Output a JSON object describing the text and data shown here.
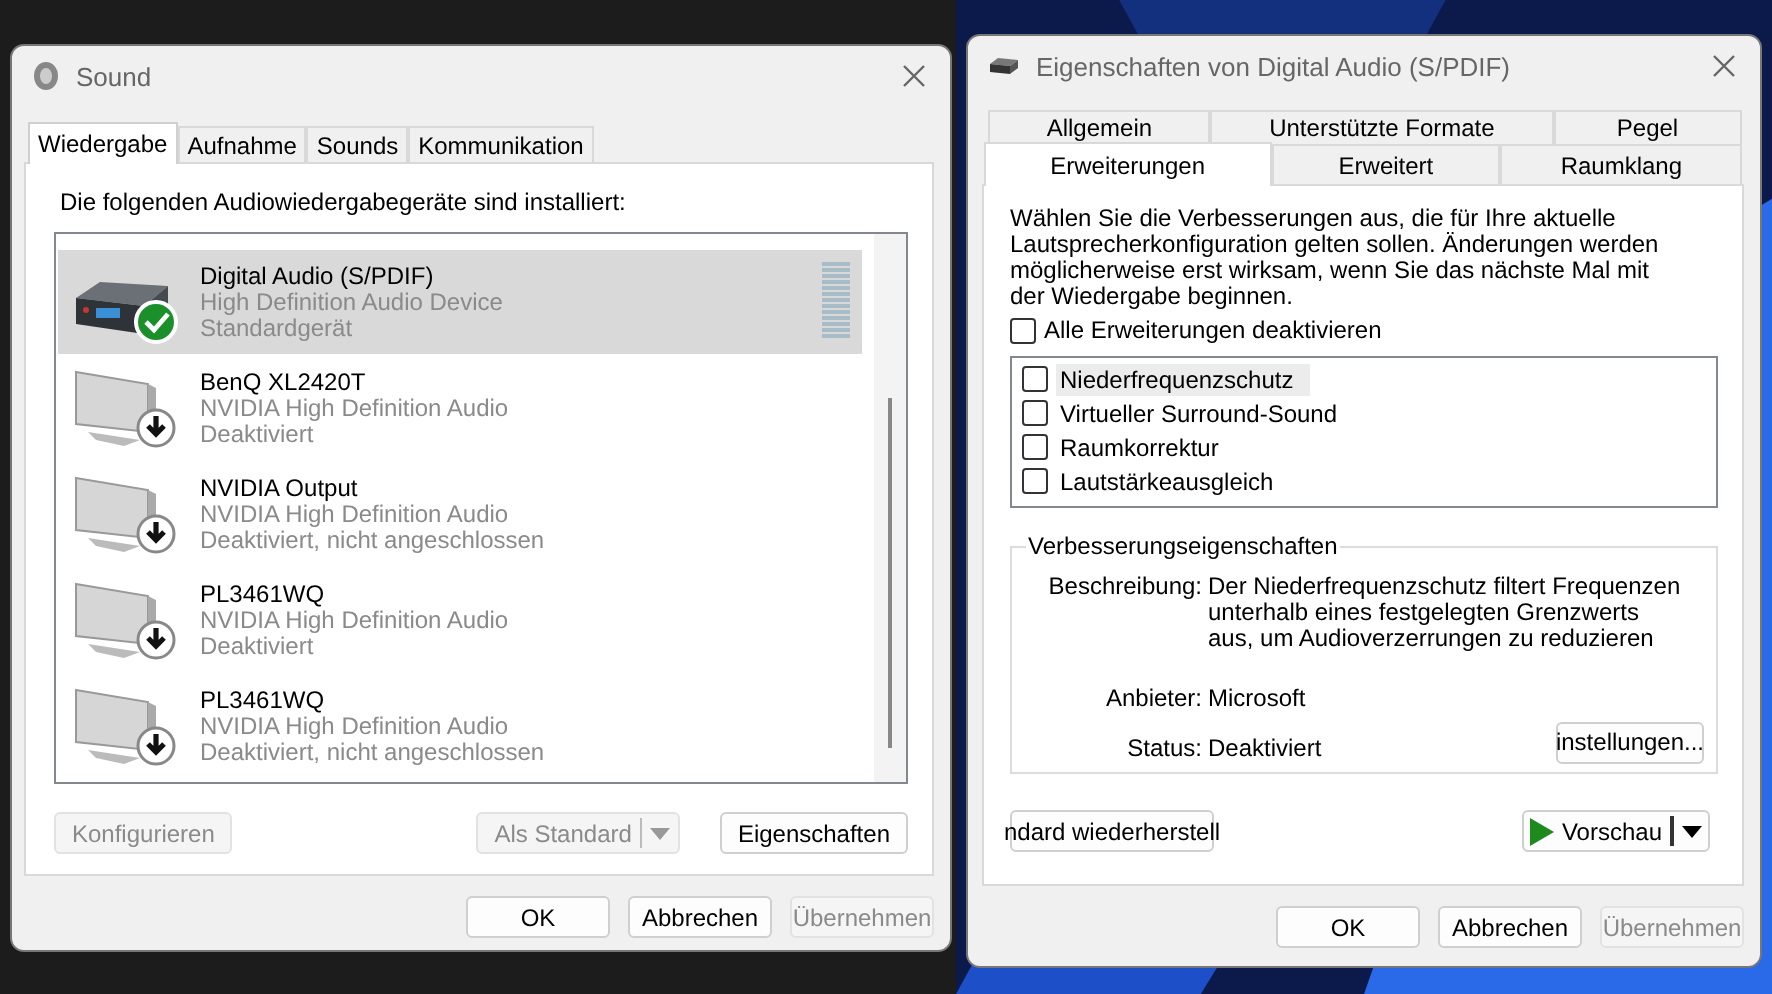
{
  "sound_window": {
    "title": "Sound",
    "tabs": [
      {
        "label": "Wiedergabe",
        "selected": true
      },
      {
        "label": "Aufnahme",
        "selected": false
      },
      {
        "label": "Sounds",
        "selected": false
      },
      {
        "label": "Kommunikation",
        "selected": false
      }
    ],
    "instruction": "Die folgenden Audiowiedergabegeräte sind installiert:",
    "devices": [
      {
        "name": "Digital Audio (S/PDIF)",
        "driver": "High Definition Audio Device",
        "status": "Standardgerät",
        "kind": "receiver",
        "default": true,
        "disabled": false,
        "selected": true
      },
      {
        "name": "BenQ XL2420T",
        "driver": "NVIDIA High Definition Audio",
        "status": "Deaktiviert",
        "kind": "monitor",
        "default": false,
        "disabled": true,
        "selected": false
      },
      {
        "name": "NVIDIA Output",
        "driver": "NVIDIA High Definition Audio",
        "status": "Deaktiviert, nicht angeschlossen",
        "kind": "monitor",
        "default": false,
        "disabled": true,
        "selected": false
      },
      {
        "name": "PL3461WQ",
        "driver": "NVIDIA High Definition Audio",
        "status": "Deaktiviert",
        "kind": "monitor",
        "default": false,
        "disabled": true,
        "selected": false
      },
      {
        "name": "PL3461WQ",
        "driver": "NVIDIA High Definition Audio",
        "status": "Deaktiviert, nicht angeschlossen",
        "kind": "monitor",
        "default": false,
        "disabled": true,
        "selected": false
      }
    ],
    "configure_button": {
      "label": "Konfigurieren",
      "disabled": true
    },
    "default_button": {
      "label": "Als Standard",
      "disabled": true
    },
    "properties_button": {
      "label": "Eigenschaften",
      "disabled": false
    },
    "footer_buttons": [
      {
        "label": "OK",
        "disabled": false
      },
      {
        "label": "Abbrechen",
        "disabled": false
      },
      {
        "label": "Übernehmen",
        "disabled": true
      }
    ]
  },
  "properties_window": {
    "title": "Eigenschaften von Digital Audio (S/PDIF)",
    "tab_rows": [
      [
        {
          "label": "Allgemein",
          "selected": false
        },
        {
          "label": "Unterstützte Formate",
          "selected": false
        },
        {
          "label": "Pegel",
          "selected": false
        }
      ],
      [
        {
          "label": "Erweiterungen",
          "selected": true
        },
        {
          "label": "Erweitert",
          "selected": false
        },
        {
          "label": "Raumklang",
          "selected": false
        }
      ]
    ],
    "intro": "Wählen Sie die Verbesserungen aus, die für Ihre aktuelle Lautsprecherkonfiguration gelten sollen. Änderungen werden möglicherweise erst wirksam, wenn Sie das nächste Mal mit der Wiedergabe beginnen.",
    "disable_all": {
      "label": "Alle Erweiterungen deaktivieren",
      "checked": false
    },
    "enhancements": [
      {
        "label": "Niederfrequenzschutz",
        "checked": false,
        "selected": true
      },
      {
        "label": "Virtueller Surround-Sound",
        "checked": false,
        "selected": false
      },
      {
        "label": "Raumkorrektur",
        "checked": false,
        "selected": false
      },
      {
        "label": "Lautstärkeausgleich",
        "checked": false,
        "selected": false
      }
    ],
    "group": {
      "title": "Verbesserungseigenschaften",
      "fields": [
        {
          "label": "Beschreibung:",
          "value": "Der Niederfrequenzschutz filtert Frequenzen unterhalb eines festgelegten Grenzwerts aus, um Audioverzerrungen zu reduzieren"
        },
        {
          "label": "Anbieter:",
          "value": "Microsoft"
        },
        {
          "label": "Status:",
          "value": "Deaktiviert"
        }
      ],
      "settings_button": "instellungen..."
    },
    "restore_button": "ndard wiederherstell",
    "preview_button": "Vorschau",
    "footer_buttons": [
      {
        "label": "OK",
        "disabled": false
      },
      {
        "label": "Abbrechen",
        "disabled": false
      },
      {
        "label": "Übernehmen",
        "disabled": true
      }
    ]
  }
}
